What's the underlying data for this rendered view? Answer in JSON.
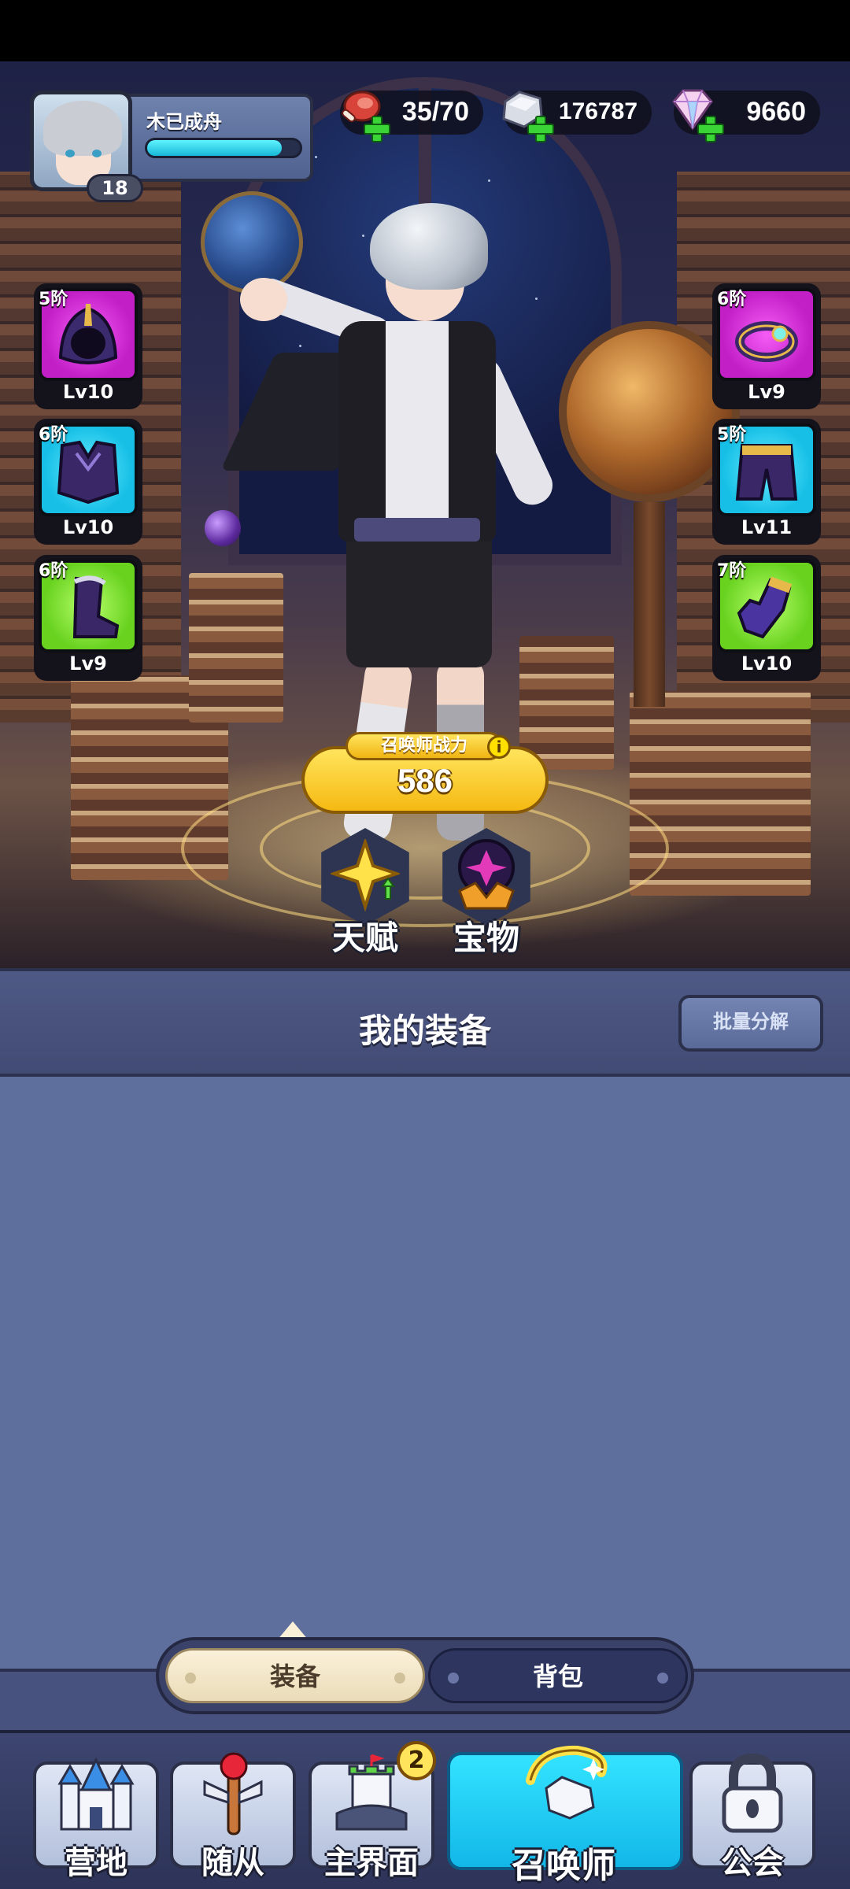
{
  "player": {
    "name": "木已成舟",
    "level": "18",
    "xp_fraction": 0.88
  },
  "resources": {
    "stamina": "35/70",
    "silver": "176787",
    "gems": "9660"
  },
  "equipment": {
    "left": [
      {
        "tier": "5阶",
        "level": "Lv10",
        "rarity": "purple",
        "icon": "hood-icon"
      },
      {
        "tier": "6阶",
        "level": "Lv10",
        "rarity": "cyan",
        "icon": "armor-icon"
      },
      {
        "tier": "6阶",
        "level": "Lv9",
        "rarity": "green",
        "icon": "boots-icon"
      }
    ],
    "right": [
      {
        "tier": "6阶",
        "level": "Lv9",
        "rarity": "purple",
        "icon": "ring-icon"
      },
      {
        "tier": "5阶",
        "level": "Lv11",
        "rarity": "cyan",
        "icon": "pants-icon"
      },
      {
        "tier": "7阶",
        "level": "Lv10",
        "rarity": "green",
        "icon": "gloves-icon"
      }
    ]
  },
  "power": {
    "label": "召唤师战力",
    "info_glyph": "i",
    "value": "586"
  },
  "actions": {
    "talent": "天赋",
    "treasure": "宝物"
  },
  "panel": {
    "title": "我的装备",
    "bulk_button": "批量分解"
  },
  "tabs": {
    "equip": "装备",
    "bag": "背包"
  },
  "nav": {
    "camp": "营地",
    "follower": "随从",
    "main": "主界面",
    "main_badge": "2",
    "summoner": "召唤师",
    "guild": "公会"
  },
  "colors": {
    "accent_cyan": "#17b8d8",
    "gold": "#f5b912",
    "panel": "#5f6f9d",
    "rarity_purple": "#c21fc7",
    "rarity_cyan": "#17bfe6",
    "rarity_green": "#68d21f"
  }
}
